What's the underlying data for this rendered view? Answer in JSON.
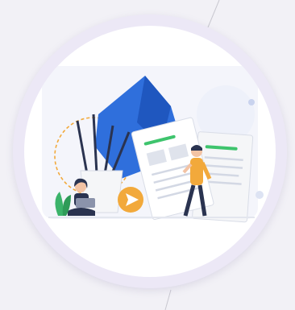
{
  "badge": {
    "illustration": "documents-and-people-icon",
    "colors": {
      "ring": "#ece8f6",
      "face": "#ffffff",
      "page_background": "#f2f1f6",
      "blue_shape": "#2f6fdc",
      "accent_orange": "#f2a93b",
      "accent_green": "#3ec46d",
      "paper": "#f5f6f8",
      "person_dark": "#2a3350",
      "plant": "#3bb36a"
    }
  }
}
